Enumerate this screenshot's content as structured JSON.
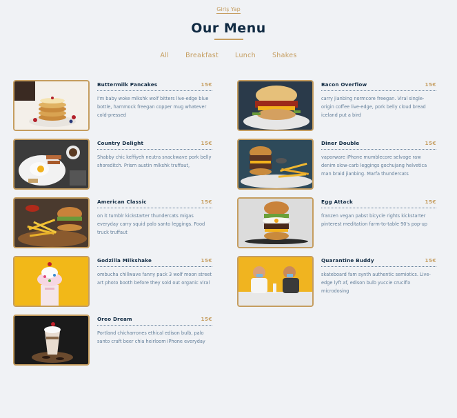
{
  "top_link": "Giriş Yap",
  "title": "Our Menu",
  "filters": [
    "All",
    "Breakfast",
    "Lunch",
    "Shakes"
  ],
  "items": [
    {
      "name": "Buttermilk Pancakes",
      "price": "15€",
      "desc": "I'm baby woke mlkshk wolf bitters live-edge blue bottle, hammock freegan copper mug whatever cold-pressed"
    },
    {
      "name": "Bacon Overflow",
      "price": "15€",
      "desc": "carry jianbing normcore freegan. Viral single-origin coffee live-edge, pork belly cloud bread iceland put a bird"
    },
    {
      "name": "Country Delight",
      "price": "15€",
      "desc": "Shabby chic keffiyeh neutra snackwave pork belly shoreditch. Prism austin mlkshk truffaut,"
    },
    {
      "name": "Diner Double",
      "price": "15€",
      "desc": "vaporware iPhone mumblecore selvage raw denim slow-carb leggings gochujang helvetica man braid jianbing. Marfa thundercats"
    },
    {
      "name": "American Classic",
      "price": "15€",
      "desc": "on it tumblr kickstarter thundercats migas everyday carry squid palo santo leggings. Food truck truffaut"
    },
    {
      "name": "Egg Attack",
      "price": "15€",
      "desc": "franzen vegan pabst bicycle rights kickstarter pinterest meditation farm-to-table 90's pop-up"
    },
    {
      "name": "Godzilla Milkshake",
      "price": "15€",
      "desc": "ombucha chillwave fanny pack 3 wolf moon street art photo booth before they sold out organic viral"
    },
    {
      "name": "Quarantine Buddy",
      "price": "15€",
      "desc": "skateboard fam synth authentic semiotics. Live-edge lyft af, edison bulb yuccie crucifix microdosing"
    },
    {
      "name": "Oreo Dream",
      "price": "15€",
      "desc": "Portland chicharrones ethical edison bulb, palo santo craft beer chia heirloom iPhone everyday"
    }
  ]
}
